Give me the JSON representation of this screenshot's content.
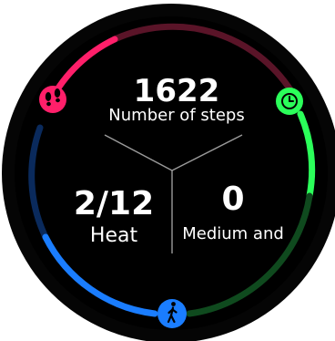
{
  "watch_face": {
    "background_color": "#000000",
    "bezel_color": "#0a0a0a",
    "ring_segments": [
      {
        "name": "steps",
        "color": "#ff1f6a",
        "dim_color": "#5a1428",
        "progress": 0.32
      },
      {
        "name": "exercise",
        "color": "#2bff5a",
        "dim_color": "#0f4a1e",
        "progress": 0.35
      },
      {
        "name": "activity",
        "color": "#1a7dff",
        "dim_color": "#0a2a5c",
        "progress": 0.55
      }
    ],
    "divider_color": "#9a9a9a"
  },
  "steps": {
    "value": "1622",
    "label": "Number of steps",
    "icon": "footprints-icon"
  },
  "heat": {
    "value": "2/12",
    "label": "Heat"
  },
  "intensity": {
    "value": "0",
    "label": "Medium and",
    "icon": "clock-icon"
  },
  "activity": {
    "icon": "walking-person-icon"
  }
}
